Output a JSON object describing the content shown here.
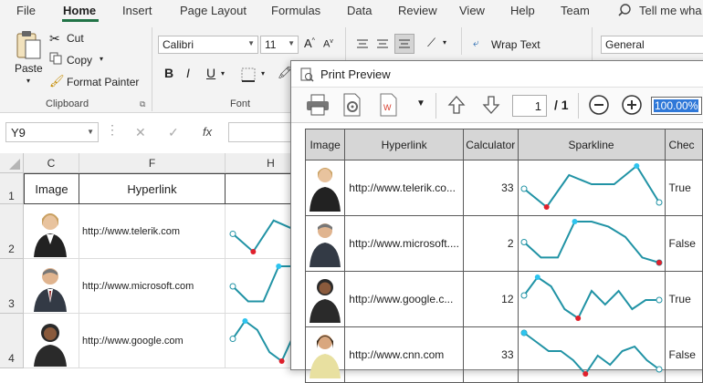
{
  "ribbon_tabs": [
    "File",
    "Home",
    "Insert",
    "Page Layout",
    "Formulas",
    "Data",
    "Review",
    "View",
    "Help",
    "Team"
  ],
  "search_placeholder": "Tell me wha",
  "clipboard": {
    "paste": "Paste",
    "cut": "Cut",
    "copy": "Copy",
    "format_painter": "Format Painter",
    "label": "Clipboard"
  },
  "font": {
    "name": "Calibri",
    "size": "11",
    "label": "Font",
    "bold": "B",
    "italic": "I",
    "underline": "U"
  },
  "alignment": {
    "wrap_text": "Wrap Text"
  },
  "number": {
    "format": "General"
  },
  "formula_bar": {
    "name_box": "Y9",
    "fx": "fx"
  },
  "sheet": {
    "columns": [
      "C",
      "F",
      "H"
    ],
    "rows": [
      "1",
      "2",
      "3",
      "4"
    ],
    "header_cells": {
      "image": "Image",
      "hyperlink": "Hyperlink"
    },
    "hyperlinks": [
      "http://www.telerik.com",
      "http://www.microsoft.com",
      "http://www.google.com"
    ]
  },
  "dialog": {
    "title": "Print Preview",
    "page_current": "1",
    "page_total": "/ 1",
    "zoom": "100.00%",
    "table": {
      "headers": [
        "Image",
        "Hyperlink",
        "Calculator",
        "Sparkline",
        "Chec"
      ],
      "rows": [
        {
          "hyperlink": "http://www.telerik.co...",
          "calc": "33",
          "check": "True"
        },
        {
          "hyperlink": "http://www.microsoft....",
          "calc": "2",
          "check": "False"
        },
        {
          "hyperlink": "http://www.google.c...",
          "calc": "12",
          "check": "True"
        },
        {
          "hyperlink": "http://www.cnn.com",
          "calc": "33",
          "check": "False"
        }
      ]
    }
  },
  "colors": {
    "accent": "#217346",
    "sparkline": "#2193a5",
    "low_point": "#e0202c",
    "high_point": "#2ec4ef"
  },
  "sparklines": [
    [
      5,
      1,
      8,
      6,
      6,
      10,
      2
    ],
    [
      5,
      2,
      2,
      9,
      9,
      8,
      6,
      2,
      1
    ],
    [
      6,
      10,
      8,
      3,
      1,
      7,
      4,
      7,
      3,
      5,
      5
    ],
    [
      10,
      8,
      6,
      6,
      4,
      1,
      5,
      3,
      6,
      7,
      4,
      2
    ]
  ]
}
